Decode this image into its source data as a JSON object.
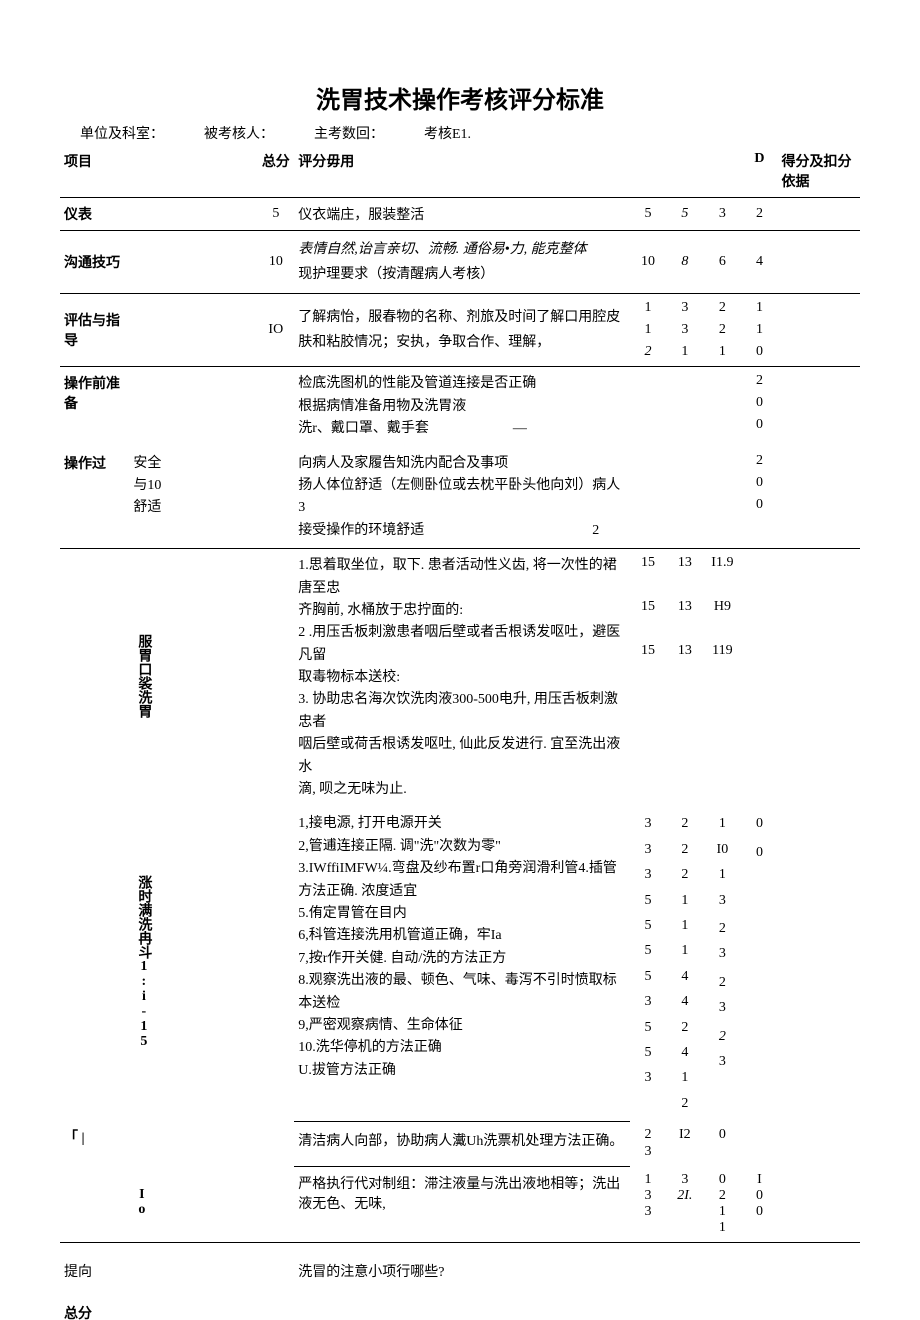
{
  "title": "洗胃技术操作考核评分标准",
  "header": {
    "unit_label": "单位及科室：",
    "examinee_label": "被考核人：",
    "examiner_label": "主考数回：",
    "assess_label": "考核E1."
  },
  "columns": {
    "item": "项目",
    "total": "总分",
    "detail": "评分毋用",
    "d": "D",
    "score": "得分及扣分依据"
  },
  "rows": {
    "appearance": {
      "label": "仪表",
      "total": "5",
      "content": "仪衣端庄，服装整活",
      "a": "5",
      "b": "5",
      "c": "3",
      "d": "2"
    },
    "communication": {
      "label": "沟通技巧",
      "total": "10",
      "content1": "表情自然,诒言亲切、流畅. 通俗易•力, 能克整体",
      "content2": "现护理要求（按清醒病人考核）",
      "a": "10",
      "b": "8",
      "c": "6",
      "d": "4"
    },
    "evaluation": {
      "label": "评估与指导",
      "total": "IO",
      "content": "了解病怡，服春物的名称、剂旅及时间了解口用腔皮肤和粘胶情况；安执，争取合作、理解，",
      "a": [
        "1",
        "1",
        "2"
      ],
      "b": [
        "3",
        "3",
        "1"
      ],
      "c": [
        "2",
        "2",
        "1"
      ],
      "d": [
        "1",
        "1",
        "0"
      ]
    },
    "prep": {
      "label": "操作前准备",
      "content": [
        "检底洗图机的性能及管道连接是否正确",
        "根据病情准备用物及洗胃液",
        "洗r、戴口罩、戴手套　　　　　　—"
      ],
      "d": [
        "2",
        "0",
        "0"
      ]
    },
    "safety": {
      "label_main": "操作过",
      "label_sub1": "安全",
      "label_sub2": "与10",
      "label_sub3": "舒适",
      "content": [
        "向病人及家履告知洗内配合及事项",
        "扬人体位舒适（左侧卧位或去枕平卧头他向刘）病人3",
        "接受操作的环境舒适　　　　　　　　　　　　2"
      ],
      "d": [
        "2",
        "0",
        "0"
      ]
    },
    "oral": {
      "vlabel": "服胃口裟洗胃",
      "lines": [
        "1.思着取坐位，取下. 患者活动性义齿, 将一次性的裙唐至忠",
        "齐胸前, 水桶放于忠拧面的:",
        "2 .用压舌板刺激患者咽后壁或者舌根诱发呕吐，避医凡留",
        "取毒物标本送校:",
        "3. 协助忠名海次饮洗肉液300-500电升, 用压舌板刺激忠者",
        "咽后壁或荷舌根诱发呕吐, 仙此反发进行. 宜至洗出液水",
        "滴, 呗之无味为止."
      ],
      "a": [
        "15",
        "15",
        "15"
      ],
      "b": [
        "13",
        "13",
        "13"
      ],
      "c": [
        "I1.9",
        "H9",
        "119"
      ]
    },
    "machine": {
      "vlabel": "涨时满洗冉斗1:i-15",
      "lines": [
        "1,接电源, 打开电源开关",
        "2,管逋连接正隔. 调\"洗\"次数为零\"",
        "3.IWffiIMFW¼.弯盘及纱布置r口角旁润滑利管4.插管方法正确. 浓度适宜",
        "5.侑定胃管在目内",
        "6,科管连接洗用机管道正确，牢Ia",
        "7,按r作开关健. 自动/洗的方法正方",
        "8.观察洗出液的最、顿色、气味、毒泻不引时愤取标本送检",
        "9,严密观察病情、生命体征",
        "10.洗华停机的方法正确",
        "U.拔管方法正确"
      ],
      "a": [
        "3",
        "3",
        "3",
        "5",
        "5",
        "5",
        "5",
        "3",
        "5",
        "5",
        "3"
      ],
      "b": [
        "2",
        "2",
        "2",
        "1",
        "1",
        "1",
        "4",
        "4",
        "2",
        "4",
        "1",
        "2"
      ],
      "c": [
        "1",
        "I0",
        "1",
        "3",
        "",
        "2",
        "3",
        "",
        "2",
        "3",
        "",
        "2",
        "3"
      ],
      "d": [
        "0",
        "",
        "0"
      ]
    },
    "clean": {
      "content": "清洁病人向部，协助病人瀻Uh洗票机处理方法正确。",
      "a": [
        "2",
        "3"
      ],
      "b": "I2",
      "c": "0"
    },
    "strict": {
      "vlabel": "Io",
      "content": "严格执行代对制组：滞注液量与洗出液地相等；洗出液无色、无味,",
      "a": [
        "1",
        "3",
        "3"
      ],
      "b": [
        "3",
        "2I."
      ],
      "c": [
        "0",
        "2",
        "1",
        "1"
      ],
      "d": [
        "I",
        "0",
        "0"
      ]
    },
    "question": {
      "label": "提向",
      "content": "洗冒的注意小项行哪些?"
    },
    "total_score": {
      "label": "总分"
    }
  }
}
